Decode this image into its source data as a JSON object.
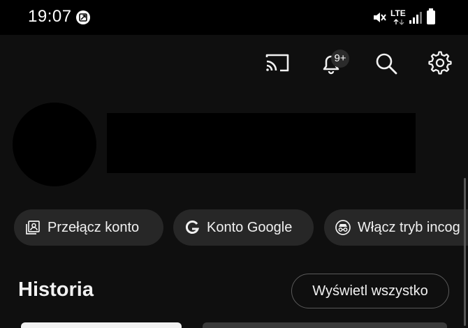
{
  "status_bar": {
    "time": "19:07",
    "network": "LTE",
    "icons": [
      "app-notification-icon",
      "mute-icon",
      "lte-icon",
      "signal-icon",
      "battery-icon"
    ]
  },
  "top_bar": {
    "icons": [
      "cast-icon",
      "notifications-icon",
      "search-icon",
      "settings-icon"
    ],
    "notification_badge": "9+"
  },
  "profile": {
    "avatar": "redacted",
    "name": "redacted"
  },
  "chips": [
    {
      "label": "Przełącz konto",
      "icon": "switch-account-icon"
    },
    {
      "label": "Konto Google",
      "icon": "google-g-icon"
    },
    {
      "label": "Włącz tryb incog",
      "icon": "incognito-icon"
    }
  ],
  "history": {
    "title": "Historia",
    "view_all_label": "Wyświetl wszystko"
  },
  "colors": {
    "background": "#0f0f0f",
    "status_bar": "#000000",
    "chip": "#272727",
    "text": "#f1f1f1"
  }
}
